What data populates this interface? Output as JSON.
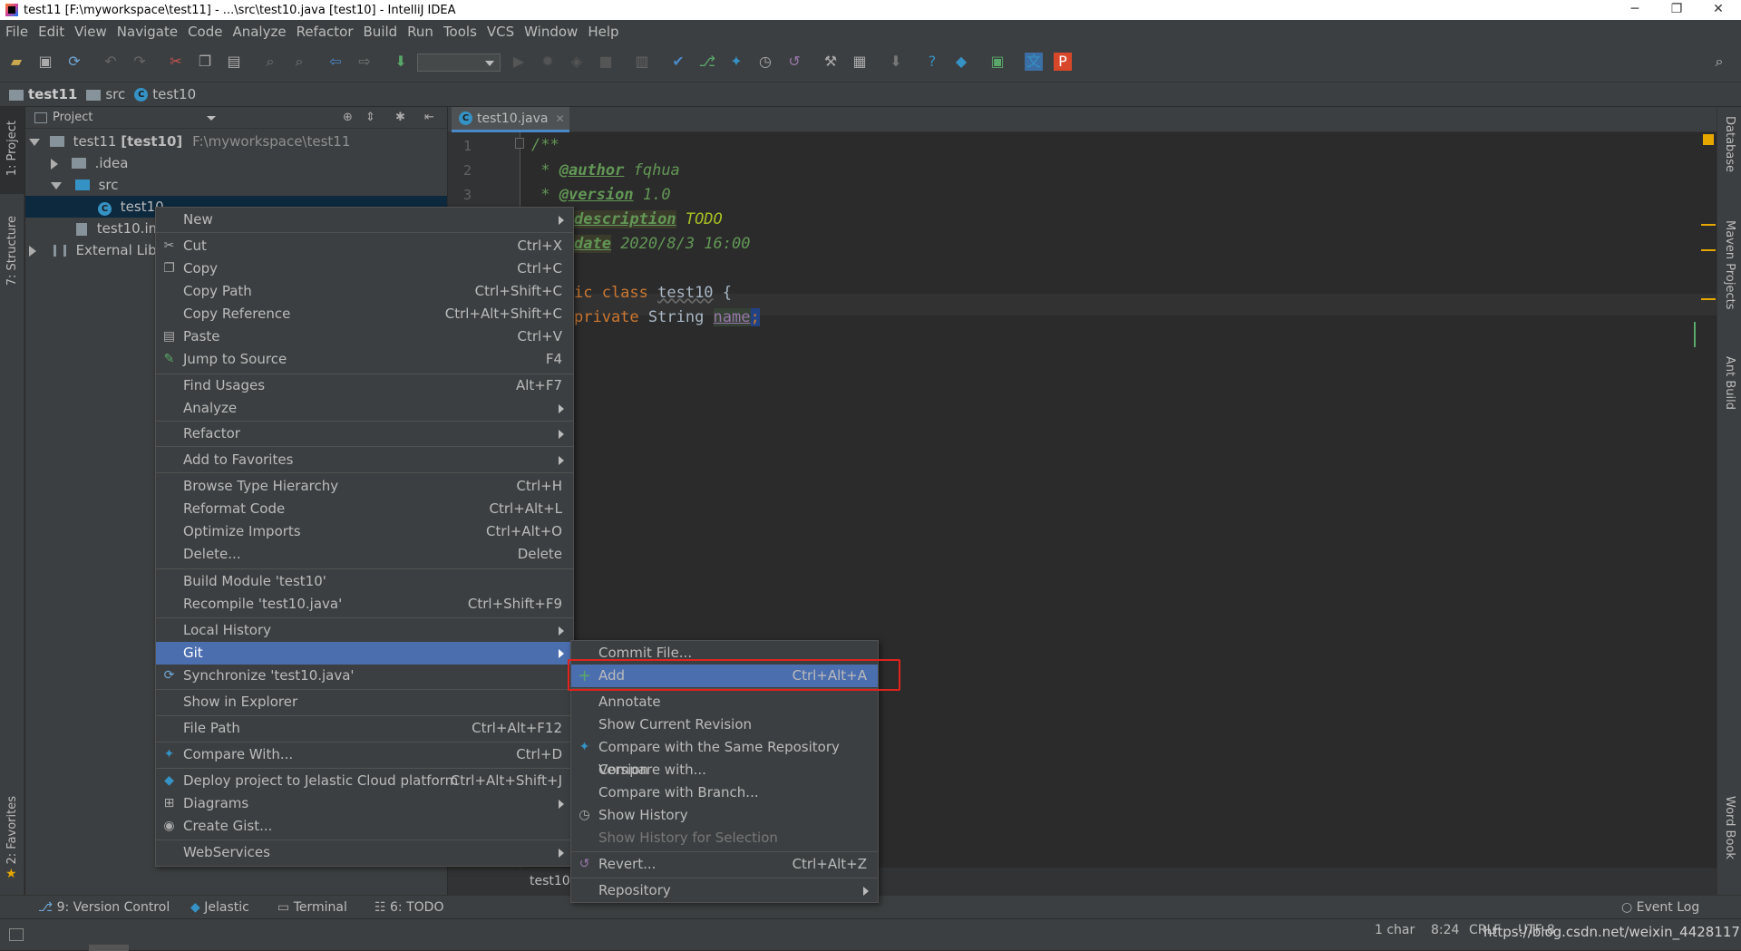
{
  "window": {
    "title": "test11 [F:\\myworkspace\\test11] - ...\\src\\test10.java [test10] - IntelliJ IDEA",
    "min": "─",
    "max": "❐",
    "close": "✕"
  },
  "menubar": [
    "File",
    "Edit",
    "View",
    "Navigate",
    "Code",
    "Analyze",
    "Refactor",
    "Build",
    "Run",
    "Tools",
    "VCS",
    "Window",
    "Help"
  ],
  "breadcrumb": {
    "project": "test11",
    "folder": "src",
    "file": "test10"
  },
  "left_tools": {
    "project": "1: Project",
    "structure": "7: Structure",
    "favorites": "2: Favorites"
  },
  "right_tools": {
    "database": "Database",
    "maven": "Maven Projects",
    "ant": "Ant Build",
    "wordbook": "Word Book"
  },
  "project_panel": {
    "header": "Project",
    "root": {
      "name": "test11",
      "module": "[test10]",
      "path": "F:\\myworkspace\\test11"
    },
    "idea": ".idea",
    "src": "src",
    "test10": "test10",
    "iml": "test10.iml",
    "ext": "External Libra"
  },
  "editor": {
    "tab": "test10.java",
    "line_numbers": [
      "1",
      "2",
      "3"
    ],
    "lines": {
      "l1": "/**",
      "l2a": " * ",
      "l2b": "@author",
      "l2c": " fqhua",
      "l3a": " * ",
      "l3b": "@version",
      "l3c": " 1.0",
      "l4b": "description",
      "l4c": " TODO",
      "l5b": "date",
      "l5c": " 2020/8/3 16:00",
      "l7a": "ic class ",
      "l7b": "test10",
      " l7c": " {",
      "l8a": "private ",
      "l8b": "String ",
      "l8c": "name",
      ";": ";"
    },
    "bottom_crumb": "test10"
  },
  "context_menu": {
    "new": "New",
    "cut": "Cut",
    "cut_sc": "Ctrl+X",
    "copy": "Copy",
    "copy_sc": "Ctrl+C",
    "copy_path": "Copy Path",
    "copy_path_sc": "Ctrl+Shift+C",
    "copy_ref": "Copy Reference",
    "copy_ref_sc": "Ctrl+Alt+Shift+C",
    "paste": "Paste",
    "paste_sc": "Ctrl+V",
    "jump": "Jump to Source",
    "jump_sc": "F4",
    "find": "Find Usages",
    "find_sc": "Alt+F7",
    "analyze": "Analyze",
    "refactor": "Refactor",
    "favorites": "Add to Favorites",
    "browse": "Browse Type Hierarchy",
    "browse_sc": "Ctrl+H",
    "reformat": "Reformat Code",
    "reformat_sc": "Ctrl+Alt+L",
    "optimize": "Optimize Imports",
    "optimize_sc": "Ctrl+Alt+O",
    "delete": "Delete...",
    "delete_sc": "Delete",
    "build": "Build Module 'test10'",
    "recompile": "Recompile 'test10.java'",
    "recompile_sc": "Ctrl+Shift+F9",
    "history": "Local History",
    "git": "Git",
    "sync": "Synchronize 'test10.java'",
    "explorer": "Show in Explorer",
    "filepath": "File Path",
    "filepath_sc": "Ctrl+Alt+F12",
    "compare": "Compare With...",
    "compare_sc": "Ctrl+D",
    "deploy": "Deploy project to Jelastic Cloud platform",
    "deploy_sc": "Ctrl+Alt+Shift+J",
    "diagrams": "Diagrams",
    "gist": "Create Gist...",
    "webservices": "WebServices"
  },
  "git_menu": {
    "commit": "Commit File...",
    "add": "Add",
    "add_sc": "Ctrl+Alt+A",
    "annotate": "Annotate",
    "show_rev": "Show Current Revision",
    "compare_repo": "Compare with the Same Repository Version",
    "compare_with": "Compare with...",
    "compare_branch": "Compare with Branch...",
    "show_history": "Show History",
    "history_sel": "Show History for Selection",
    "revert": "Revert...",
    "revert_sc": "Ctrl+Alt+Z",
    "repository": "Repository"
  },
  "bottom_tools": {
    "vc": "9: Version Control",
    "jelastic": "Jelastic",
    "terminal": "Terminal",
    "todo": "6: TODO",
    "eventlog": "Event Log"
  },
  "status": {
    "chars": "1 char",
    "pos": "8:24",
    "crlf": "CRLF",
    "enc": "UTF-8",
    "watermark": "https://blog.csdn.net/weixin_44281173"
  }
}
